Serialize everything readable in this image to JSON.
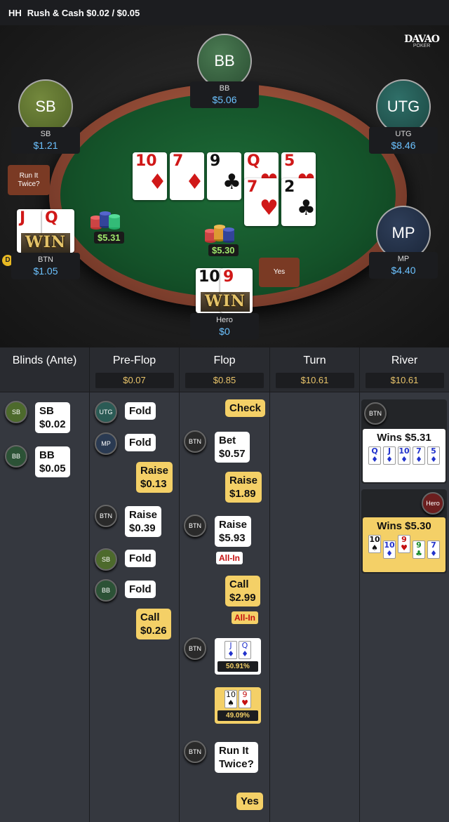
{
  "header": {
    "hh": "HH",
    "title": "Rush & Cash $0.02 / $0.05"
  },
  "logo": {
    "line1": "DAVAO",
    "line2": "POKER"
  },
  "seats": {
    "bb": {
      "circle": "BB",
      "name": "BB",
      "stack": "$5.06"
    },
    "sb": {
      "circle": "SB",
      "name": "SB",
      "stack": "$1.21"
    },
    "utg": {
      "circle": "UTG",
      "name": "UTG",
      "stack": "$8.46"
    },
    "mp": {
      "circle": "MP",
      "name": "MP",
      "stack": "$4.40"
    },
    "btn": {
      "name": "BTN",
      "stack": "$1.05",
      "card1": "J",
      "card2": "Q",
      "win": "WIN"
    },
    "hero": {
      "name": "Hero",
      "stack": "$0",
      "card1": "10",
      "card2": "9",
      "win": "WIN"
    }
  },
  "dealer_chip": "D",
  "run_it_twice_button": "Run It Twice?",
  "yes_button": "Yes",
  "pots": {
    "pot1": "$5.31",
    "pot2": "$5.30"
  },
  "board_top": [
    {
      "rank": "10",
      "suit": "♦",
      "color": "red"
    },
    {
      "rank": "7",
      "suit": "♦",
      "color": "red"
    },
    {
      "rank": "9",
      "suit": "♣",
      "color": "black"
    },
    {
      "rank": "Q",
      "suit": "♥",
      "color": "red"
    },
    {
      "rank": "5",
      "suit": "♥",
      "color": "red"
    }
  ],
  "board_bottom": [
    {
      "rank": "7",
      "suit": "♥",
      "color": "red"
    },
    {
      "rank": "2",
      "suit": "♣",
      "color": "black"
    }
  ],
  "history": {
    "columns": [
      {
        "title": "Blinds (Ante)",
        "pot": ""
      },
      {
        "title": "Pre-Flop",
        "pot": "$0.07"
      },
      {
        "title": "Flop",
        "pot": "$0.85"
      },
      {
        "title": "Turn",
        "pot": "$10.61"
      },
      {
        "title": "River",
        "pot": "$10.61"
      }
    ],
    "blinds": [
      {
        "pos": "SB",
        "line1": "SB",
        "line2": "$0.02"
      },
      {
        "pos": "BB",
        "line1": "BB",
        "line2": "$0.05"
      }
    ],
    "preflop": [
      {
        "pos": "UTG",
        "action": "Fold"
      },
      {
        "pos": "MP",
        "action": "Fold"
      },
      {
        "action": "Raise",
        "amount": "$0.13"
      },
      {
        "pos": "BTN",
        "action": "Raise",
        "amount": "$0.39"
      },
      {
        "pos": "SB",
        "action": "Fold"
      },
      {
        "pos": "BB",
        "action": "Fold"
      },
      {
        "action": "Call",
        "amount": "$0.26"
      }
    ],
    "flop": {
      "check": "Check",
      "bet": {
        "pos": "BTN",
        "action": "Bet",
        "amount": "$0.57"
      },
      "raise1": {
        "action": "Raise",
        "amount": "$1.89"
      },
      "raise2": {
        "pos": "BTN",
        "action": "Raise",
        "amount": "$5.93",
        "allin": "All-In"
      },
      "call": {
        "action": "Call",
        "amount": "$2.99",
        "allin": "All-In"
      },
      "btn_equity": {
        "pos": "BTN",
        "cards": [
          "J",
          "Q"
        ],
        "pct": "50.91%"
      },
      "hero_equity": {
        "cards": [
          "10",
          "9"
        ],
        "pct": "49.09%"
      },
      "rit": {
        "pos": "BTN",
        "line1": "Run It",
        "line2": "Twice?"
      },
      "yes": "Yes"
    },
    "river": {
      "btn": {
        "pos": "BTN",
        "wins": "Wins $5.31",
        "cards": [
          "Q",
          "J",
          "10",
          "7",
          "5"
        ]
      },
      "hero": {
        "pos": "Hero",
        "wins": "Wins $5.30",
        "cards": [
          "10",
          "10",
          "9",
          "9",
          "7"
        ]
      }
    }
  }
}
